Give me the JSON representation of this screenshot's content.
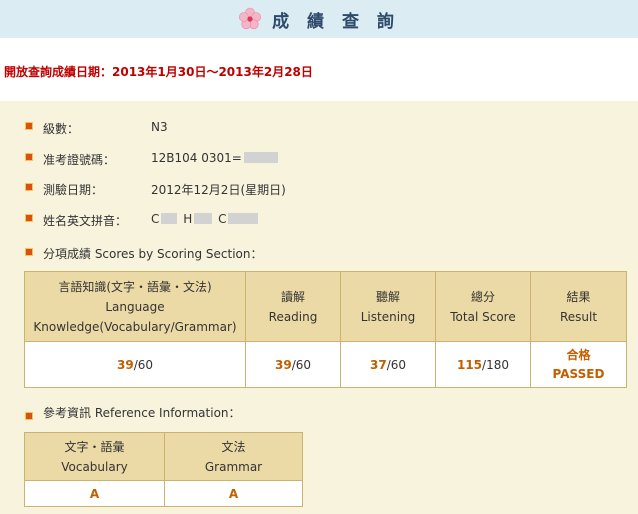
{
  "header": {
    "title": "成 績 查 詢"
  },
  "notice": "開放查詢成績日期：2013年1月30日～2013年2月28日",
  "info": [
    {
      "label": "級數：",
      "value": "N3"
    },
    {
      "label": "准考證號碼：",
      "value": "12B104 0301="
    },
    {
      "label": "測驗日期：",
      "value": "2012年12月2日(星期日)"
    },
    {
      "label": "姓名英文拼音：",
      "value_parts": [
        "C",
        "H",
        "C"
      ]
    }
  ],
  "scores": {
    "heading": "分項成績 Scores by Scoring Section：",
    "columns": [
      {
        "line1": "言語知識(文字・語彙・文法)",
        "line2": "Language",
        "line3": "Knowledge(Vocabulary/Grammar)"
      },
      {
        "line1": "讀解",
        "line2": "Reading"
      },
      {
        "line1": "聽解",
        "line2": "Listening"
      },
      {
        "line1": "總分",
        "line2": "Total Score"
      },
      {
        "line1": "結果",
        "line2": "Result"
      }
    ],
    "values": [
      {
        "score": "39",
        "max": "/60"
      },
      {
        "score": "39",
        "max": "/60"
      },
      {
        "score": "37",
        "max": "/60"
      },
      {
        "score": "115",
        "max": "/180"
      }
    ],
    "result": {
      "line1": "合格",
      "line2": "PASSED"
    }
  },
  "reference": {
    "heading": "參考資訊 Reference Information：",
    "columns": [
      {
        "line1": "文字・語彙",
        "line2": "Vocabulary"
      },
      {
        "line1": "文法",
        "line2": "Grammar"
      }
    ],
    "values": [
      "A",
      "A"
    ]
  }
}
